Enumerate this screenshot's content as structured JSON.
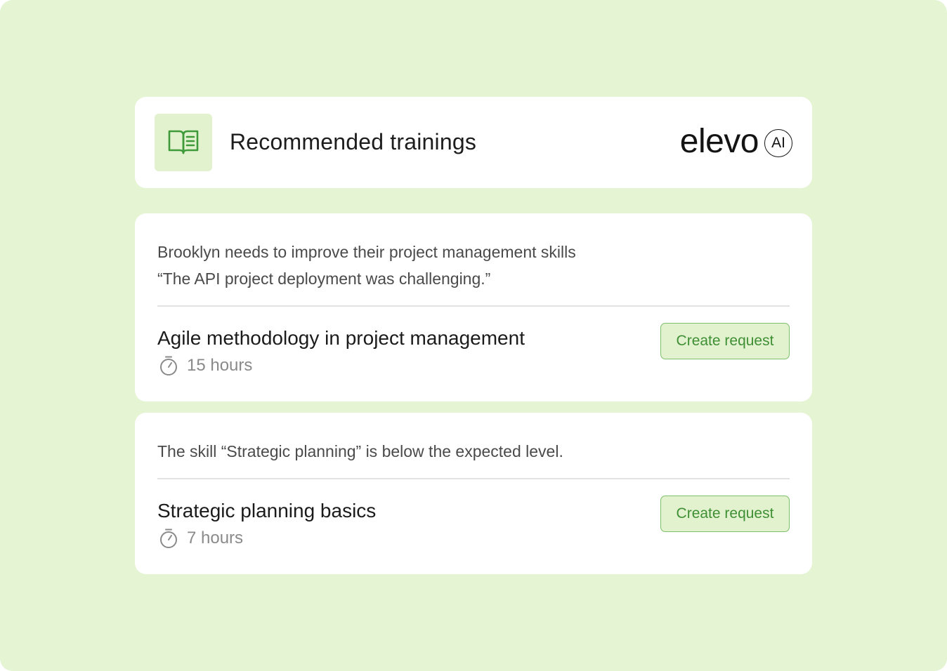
{
  "header": {
    "title": "Recommended trainings",
    "brand_word": "elevo",
    "brand_badge": "AI",
    "icon": "open-book-icon"
  },
  "recommendations": [
    {
      "reason_lines": [
        "Brooklyn needs to improve their project management skills",
        "“The API project deployment was challenging.”"
      ],
      "course_title": "Agile methodology in project management",
      "duration": "15 hours",
      "button_label": "Create request"
    },
    {
      "reason_lines": [
        "The skill “Strategic planning” is below the expected level."
      ],
      "course_title": "Strategic planning basics",
      "duration": "7 hours",
      "button_label": "Create request"
    }
  ],
  "colors": {
    "background": "#e5f4d2",
    "accent": "#3f8f35",
    "accent_fill": "#e2f2cf"
  }
}
